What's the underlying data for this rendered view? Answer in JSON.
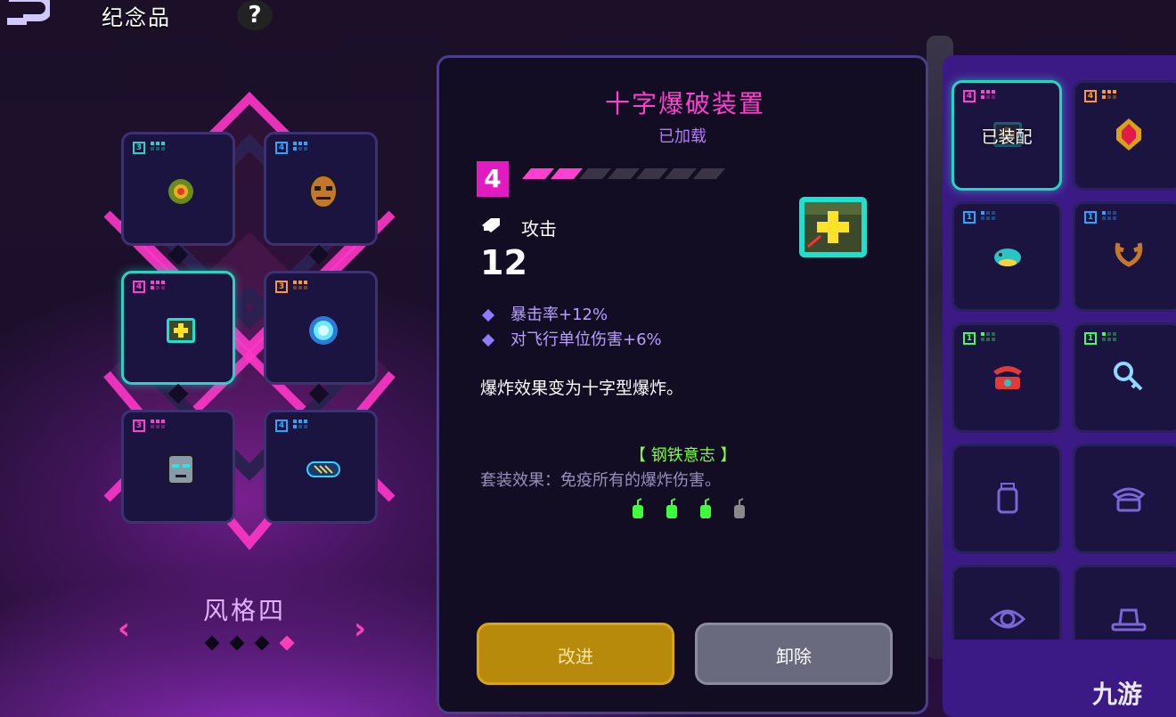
{
  "header": {
    "title": "纪念品",
    "help": "?"
  },
  "loadout": {
    "style_name": "风格四",
    "prev": "‹",
    "next": "›",
    "pages": 4,
    "active_page": 4,
    "slots": [
      {
        "tier": "3",
        "color": "#27d3c4",
        "icon": "sunflower-icon"
      },
      {
        "tier": "4",
        "color": "#27a8ff",
        "icon": "mask-icon"
      },
      {
        "tier": "4",
        "color": "#ff3fd0",
        "icon": "cross-blast-icon",
        "selected": true
      },
      {
        "tier": "3",
        "color": "#ff9a2a",
        "icon": "blue-gem-icon"
      },
      {
        "tier": "3",
        "color": "#ff3fd0",
        "icon": "robot-face-icon"
      },
      {
        "tier": "4",
        "color": "#27a8ff",
        "icon": "scroll-icon"
      }
    ]
  },
  "detail": {
    "title": "十字爆破装置",
    "status": "已加载",
    "tier": "4",
    "upgrade_level": 2,
    "upgrade_max": 7,
    "stat_label": "攻击",
    "stat_value": "12",
    "bonuses": [
      "暴击率+12%",
      "对飞行单位伤害+6%"
    ],
    "description": "爆炸效果变为十字型爆炸。",
    "set_name": "【 钢铁意志 】",
    "set_effect": "套装效果：免疫所有的爆炸伤害。",
    "set_progress": 3,
    "set_total": 4,
    "upgrade_button": "改进",
    "remove_button": "卸除"
  },
  "inventory": {
    "equipped_label": "已装配",
    "items": [
      {
        "tier": "4",
        "color": "#ff3fd0",
        "icon": "cross-blast-icon",
        "equipped": true
      },
      {
        "tier": "4",
        "color": "#ff9a2a",
        "icon": "red-gem-icon"
      },
      {
        "tier": "1",
        "color": "#27a8ff",
        "icon": "fish-icon"
      },
      {
        "tier": "1",
        "color": "#27a8ff",
        "icon": "antlers-icon"
      },
      {
        "tier": "1",
        "color": "#3cff66",
        "icon": "telephone-icon"
      },
      {
        "tier": "1",
        "color": "#3cff66",
        "icon": "key-icon"
      },
      {
        "tier": "",
        "color": "#7a66d6",
        "icon": "bottle-icon",
        "locked": true
      },
      {
        "tier": "",
        "color": "#7a66d6",
        "icon": "phone-locked-icon",
        "locked": true
      },
      {
        "tier": "",
        "color": "#7a66d6",
        "icon": "eye-icon",
        "locked": true
      },
      {
        "tier": "",
        "color": "#7a66d6",
        "icon": "hat-icon",
        "locked": true
      }
    ]
  },
  "watermark": "九游"
}
